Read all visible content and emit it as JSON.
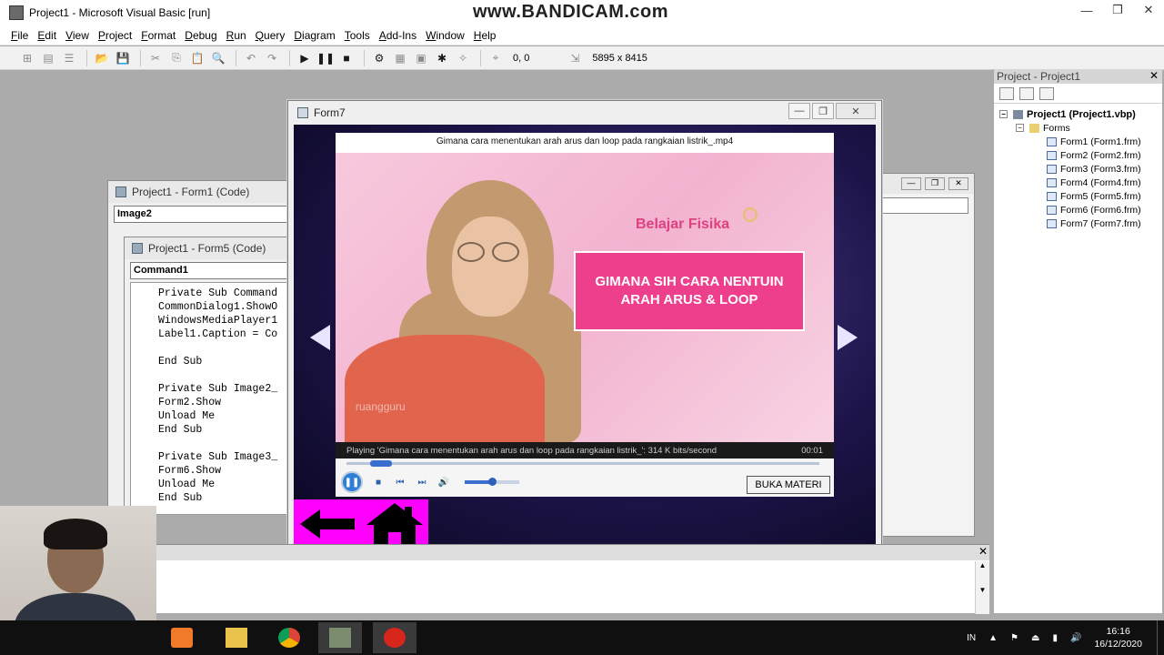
{
  "window": {
    "title": "Project1 - Microsoft Visual Basic [run]",
    "watermark": "www.BANDICAM.com",
    "minimize": "—",
    "maximize": "❐",
    "close": "✕"
  },
  "menu": [
    "File",
    "Edit",
    "View",
    "Project",
    "Format",
    "Debug",
    "Run",
    "Query",
    "Diagram",
    "Tools",
    "Add-Ins",
    "Window",
    "Help"
  ],
  "toolbar": {
    "position": "0, 0",
    "size": "5895 x 8415"
  },
  "code_windows": {
    "form1": {
      "title": "Project1 - Form1 (Code)",
      "object": "Image2"
    },
    "form5": {
      "title": "Project1 - Form5 (Code)",
      "object": "Command1",
      "lines": "Private Sub Command\nCommonDialog1.ShowO\nWindowsMediaPlayer1\nLabel1.Caption = Co\n\nEnd Sub\n\nPrivate Sub Image2_\nForm2.Show\nUnload Me\nEnd Sub\n\nPrivate Sub Image3_\nForm6.Show\nUnload Me\nEnd Sub"
    }
  },
  "form7": {
    "title": "Form7",
    "player": {
      "file_title": "Gimana cara menentukan arah arus dan loop pada rangkaian listrik_.mp4",
      "video_brand": "Belajar Fisika",
      "video_banner": "GIMANA SIH CARA NENTUIN ARAH ARUS & LOOP",
      "video_logo": "ruangguru",
      "status": "Playing 'Gimana cara menentukan arah arus dan loop pada rangkaian listrik_': 314 K bits/second",
      "time": "00:01",
      "progress_fraction": 0.05,
      "volume_fraction": 0.5
    },
    "buka_button": "BUKA MATERI"
  },
  "project_explorer": {
    "title": "Project - Project1",
    "root": "Project1 (Project1.vbp)",
    "folder": "Forms",
    "forms": [
      "Form1 (Form1.frm)",
      "Form2 (Form2.frm)",
      "Form3 (Form3.frm)",
      "Form4 (Form4.frm)",
      "Form5 (Form5.frm)",
      "Form6 (Form6.frm)",
      "Form7 (Form7.frm)"
    ]
  },
  "taskbar": {
    "apps": [
      "media-player-icon",
      "file-explorer-icon",
      "chrome-icon",
      "vb6-icon",
      "bandicam-icon"
    ],
    "lang": "IN",
    "time": "16:16",
    "date": "16/12/2020"
  },
  "colors": {
    "accent_pink": "#ff00ff",
    "banner_pink": "#ee3f8d",
    "wmp_blue": "#2f7ed8"
  }
}
